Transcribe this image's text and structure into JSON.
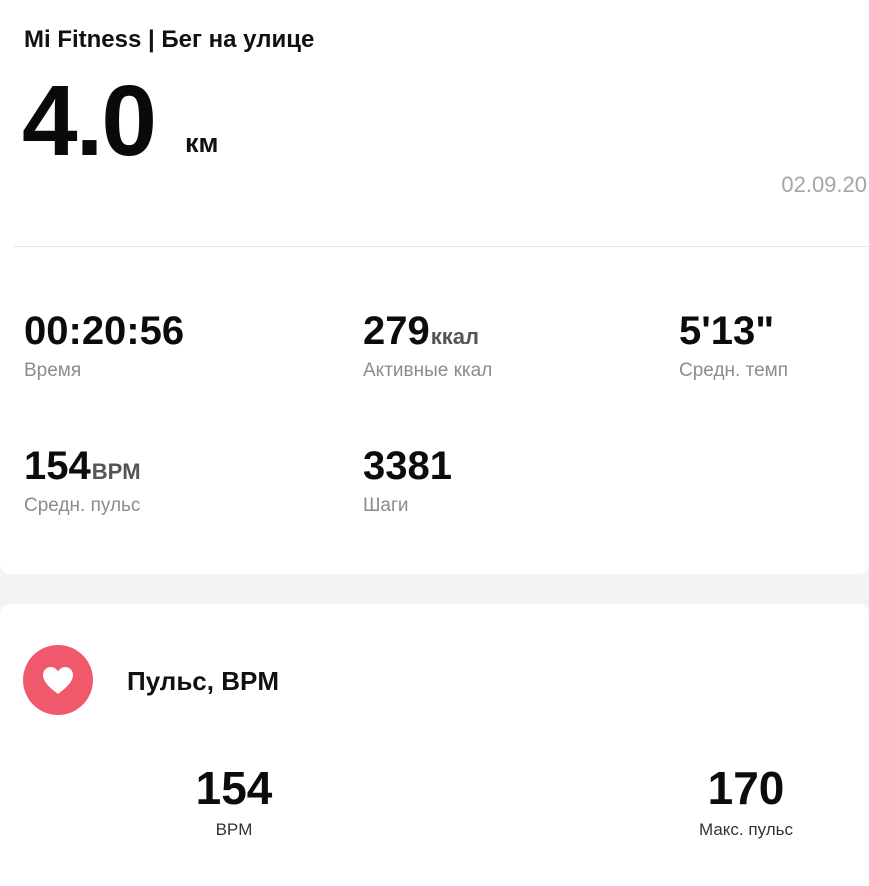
{
  "header": {
    "title": "Mi Fitness | Бег на улице",
    "distance_value": "4.0",
    "distance_unit": "км",
    "date": "02.09.20"
  },
  "stats": [
    {
      "value": "00:20:56",
      "unit": "",
      "label": "Время"
    },
    {
      "value": "279",
      "unit": "ккал",
      "label": "Активные ккал"
    },
    {
      "value": "5'13\"",
      "unit": "",
      "label": "Средн. темп"
    },
    {
      "value": "154",
      "unit": "BPM",
      "label": "Средн. пульс"
    },
    {
      "value": "3381",
      "unit": "",
      "label": "Шаги"
    }
  ],
  "pulse": {
    "icon": "heart-icon",
    "accent_color": "#f0596b",
    "title": "Пульс, BPM",
    "avg": {
      "value": "154",
      "label": "BPM"
    },
    "max": {
      "value": "170",
      "label": "Макс. пульс"
    }
  }
}
